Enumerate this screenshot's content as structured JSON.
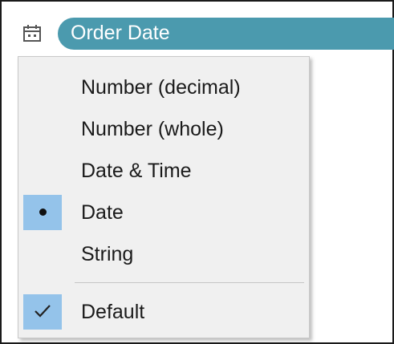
{
  "field": {
    "icon": "calendar-icon",
    "name": "Order Date",
    "pill_color": "#4b9aae"
  },
  "menu": {
    "items": [
      {
        "label": "Number (decimal)",
        "state": "none"
      },
      {
        "label": "Number (whole)",
        "state": "none"
      },
      {
        "label": "Date & Time",
        "state": "none"
      },
      {
        "label": "Date",
        "state": "selected-bullet"
      },
      {
        "label": "String",
        "state": "none"
      }
    ],
    "default_item": {
      "label": "Default",
      "state": "checked"
    },
    "highlight_color": "#94c3ea"
  }
}
